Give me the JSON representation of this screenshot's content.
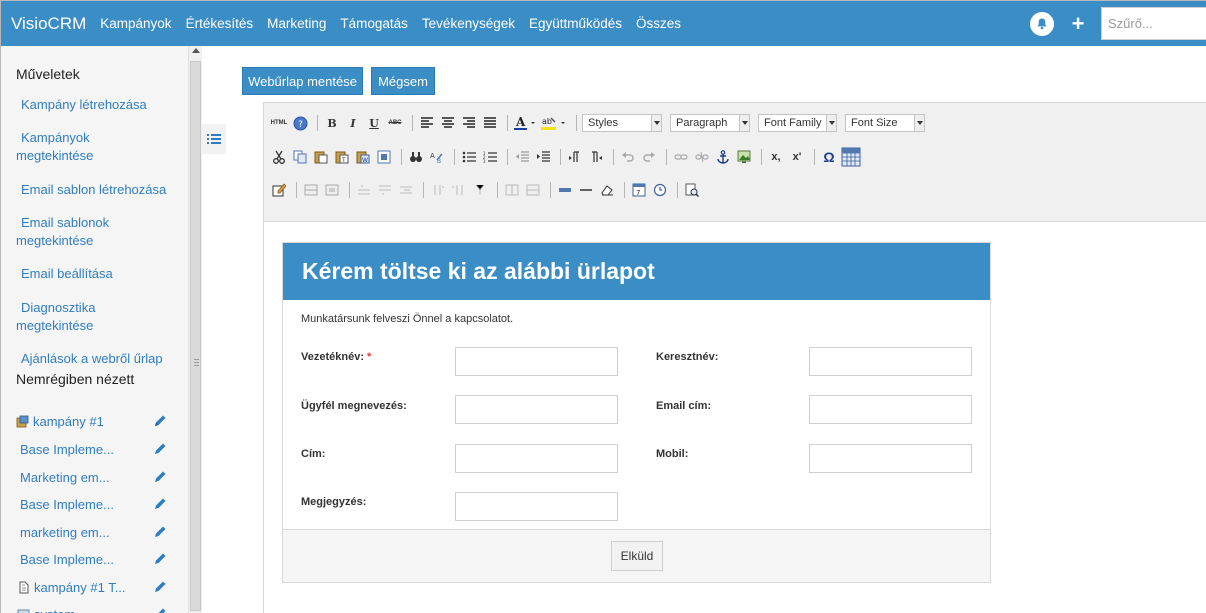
{
  "navbar": {
    "brand": "VisioCRM",
    "links": [
      "Kampányok",
      "Értékesítés",
      "Marketing",
      "Támogatás",
      "Tevékenységek",
      "Együttműködés",
      "Összes"
    ],
    "search_placeholder": "Szűrő..."
  },
  "sidebar": {
    "actions_title": "Műveletek",
    "actions": [
      {
        "line1": "Kampány létrehozása",
        "line2": ""
      },
      {
        "line1": "Kampányok",
        "line2": "megtekintése"
      },
      {
        "line1": "Email sablon létrehozása",
        "line2": ""
      },
      {
        "line1": "Email sablonok",
        "line2": "megtekintése"
      },
      {
        "line1": "Email beállítása",
        "line2": ""
      },
      {
        "line1": "Diagnosztika",
        "line2": "megtekintése"
      },
      {
        "line1": "Ajánlások a webről űrlap",
        "line2": ""
      }
    ],
    "recent_title": "Nemrégiben nézett",
    "recent": [
      "kampány #1",
      "Base Impleme...",
      "Marketing em...",
      "Base Impleme...",
      "marketing em...",
      "Base Impleme...",
      "kampány #1 T...",
      "system"
    ]
  },
  "main": {
    "save_label": "Webűrlap mentése",
    "cancel_label": "Mégsem"
  },
  "toolbar": {
    "html_label": "HTML",
    "bold": "B",
    "italic": "I",
    "underline": "U",
    "strike": "ABC",
    "styles": "Styles",
    "paragraph": "Paragraph",
    "font_family": "Font Family",
    "font_size": "Font Size",
    "omega": "Ω",
    "sub": "x,",
    "sup": "x'"
  },
  "form": {
    "title": "Kérem töltse ki az alábbi ürlapot",
    "subtitle": "Munkatársunk felveszi Önnel a kapcsolatot.",
    "fields": {
      "lastname": "Vezetéknév:",
      "required_mark": "*",
      "firstname": "Keresztnév:",
      "company": "Ügyfél megnevezés:",
      "email": "Email cím:",
      "address": "Cím:",
      "mobile": "Mobil:",
      "note": "Megjegyzés:"
    },
    "submit_label": "Elküld"
  },
  "colors": {
    "primary": "#3b8dc5",
    "link": "#2f7dc1",
    "required": "#e33333"
  }
}
